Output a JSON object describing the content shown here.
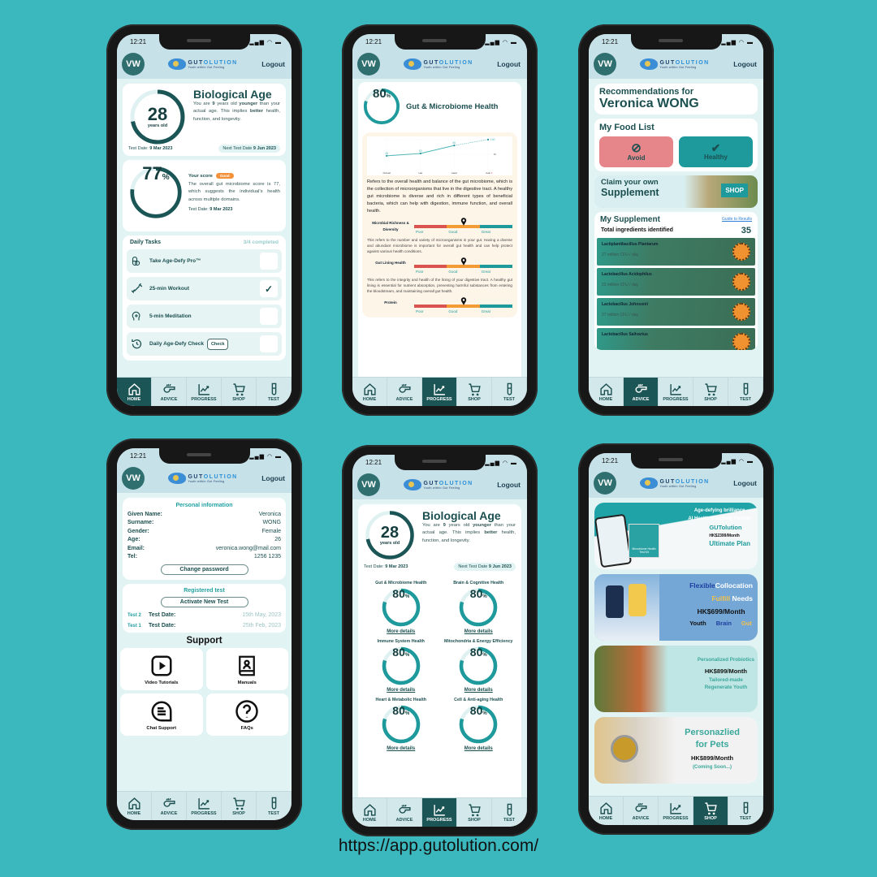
{
  "status_time": "12:21",
  "header": {
    "avatar": "VW",
    "brand_a": "GUT",
    "brand_b": "OLUTION",
    "tagline": "Youth within Gut Feeling",
    "logout": "Logout"
  },
  "nav": [
    {
      "label": "HOME",
      "icon": "home-icon"
    },
    {
      "label": "ADVICE",
      "icon": "whistle-icon"
    },
    {
      "label": "PROGRESS",
      "icon": "progress-chart-icon"
    },
    {
      "label": "SHOP",
      "icon": "cart-icon"
    },
    {
      "label": "TEST",
      "icon": "test-tube-icon"
    }
  ],
  "colors": {
    "background": "#3bb8be",
    "dark_teal": "#1b5556",
    "teal": "#1f9a9c",
    "poor": "#d9534f",
    "good": "#f39c35",
    "great": "#1f9a9c",
    "badge": "#f2913a"
  },
  "home": {
    "active_nav": "HOME",
    "bio": {
      "age": "28",
      "unit": "years old",
      "ring_fill": 0.72,
      "title": "Biological Age",
      "desc_1": "You are ",
      "years": "9",
      "desc_2": " years old ",
      "younger": "younger",
      "desc_3": " than your actual age.  This implies ",
      "better": "better",
      "desc_4": " health, function, and longevity.",
      "test_date_label": "Test Date: ",
      "test_date": "9 Mar 2023",
      "next_label": "Next Test Date ",
      "next_date": "9 Jun 2023"
    },
    "score": {
      "value": "77",
      "pct": "%",
      "ring_fill": 0.77,
      "label": "Your score",
      "badge": "Good",
      "desc": "The overall gut microbiome score is 77, which suggests the individual's health across multiple domains.",
      "test_date_label": "Test Date: ",
      "test_date": "9 Mar 2023"
    },
    "tasks": {
      "title": "Daily Tasks",
      "completed": "3/4 completed",
      "items": [
        {
          "label": "Take Age-Defy Pro™",
          "icon": "pill-icon",
          "done": false
        },
        {
          "label": "25-min Workout",
          "icon": "dumbbell-icon",
          "done": true
        },
        {
          "label": "5-min Meditation",
          "icon": "meditation-head-icon",
          "done": false
        },
        {
          "label": "Daily Age-Defy Check",
          "icon": "history-icon",
          "done": false,
          "button": "Check"
        }
      ]
    }
  },
  "progress_detail": {
    "active_nav": "PROGRESS",
    "score": "80",
    "pct": "%",
    "ring_fill": 0.8,
    "title": "Gut & Microbiome Health",
    "desc": "Refers to the overall health and balance of the gut microbiome, which is the collection of microorganisms that live in the digestive tract. A healthy gut microbiome is diverse and rich in different types of beneficial bacteria, which can help with digestion, immune function, and overall health.",
    "scale": [
      "Poor",
      "Good",
      "Great"
    ],
    "metrics": [
      {
        "label": "Microbial Richness & Diversity",
        "level": "Good",
        "desc": "This refers to the number and variety of microorganisms in your gut. Having a diverse and abundant microbiome is important for overall gut health and can help protect against various health conditions."
      },
      {
        "label": "Gut Lining Health",
        "level": "Good",
        "desc": "This refers to the integrity and health of the lining of your digestive tract. A healthy gut lining is essential for nutrient absorption, preventing harmful substances from entering the bloodstream, and maintaining overall gut health."
      },
      {
        "label": "Protein",
        "level": "Good",
        "desc": ""
      }
    ]
  },
  "chart_data": {
    "type": "line",
    "categories": [
      "2nd Last",
      "Last",
      "Latest",
      "Goal"
    ],
    "values": [
      45,
      53,
      80,
      100
    ],
    "ylim": [
      0,
      100
    ],
    "yticks": [
      "50",
      "100"
    ],
    "goal_marker": "0",
    "grid": true,
    "goal_segment": "dashed"
  },
  "advice": {
    "active_nav": "ADVICE",
    "rec_label": "Recommendations for",
    "rec_name": "Veronica WONG",
    "food_title": "My Food List",
    "avoid": "Avoid",
    "healthy": "Healthy",
    "claim_1": "Claim your own",
    "claim_2": "Supplement",
    "shop": "SHOP",
    "supp_title": "My Supplement",
    "guide": "Guide to Results",
    "total_label": "Total ingredients identified",
    "total": "35",
    "supplements": [
      {
        "name": "Lactiplantibacillus Plantarum",
        "dose": "27 million CFU / day"
      },
      {
        "name": "Lactobacillus Acidophilus",
        "dose": "22 million CFU / day"
      },
      {
        "name": "Lactobacillus Johnsonii",
        "dose": "27 million CFU / day"
      },
      {
        "name": "Lactobacillus Salivarius",
        "dose": ""
      }
    ]
  },
  "profile": {
    "active_nav": "",
    "personal_title": "Personal information",
    "fields": [
      {
        "k": "Given Name:",
        "v": "Veronica"
      },
      {
        "k": "Surname:",
        "v": "WONG"
      },
      {
        "k": "Gender:",
        "v": "Female"
      },
      {
        "k": "Age:",
        "v": "26"
      },
      {
        "k": "Email:",
        "v": "veronica.wong@mail.com"
      },
      {
        "k": "Tel:",
        "v": "1256 1235"
      }
    ],
    "change_password": "Change password",
    "registered_title": "Registered test",
    "activate": "Activate New Test",
    "tests": [
      {
        "id": "Test 2",
        "label": "Test Date:",
        "date": "15th May, 2023"
      },
      {
        "id": "Test 1",
        "label": "Test Date:",
        "date": "25th Feb, 2023"
      }
    ],
    "support_title": "Support",
    "support": [
      {
        "label": "Video Tutorials",
        "icon": "video-play-icon"
      },
      {
        "label": "Manuals",
        "icon": "manual-book-icon"
      },
      {
        "label": "Chat Support",
        "icon": "chat-icon"
      },
      {
        "label": "FAQs",
        "icon": "question-icon"
      }
    ]
  },
  "progress": {
    "active_nav": "PROGRESS",
    "categories": [
      {
        "title": "Gut & Microbiome Health",
        "value": "80",
        "ring_fill": 0.8
      },
      {
        "title": "Brain & Cognitive Health",
        "value": "80",
        "ring_fill": 0.8
      },
      {
        "title": "Immune System Health",
        "value": "80",
        "ring_fill": 0.8
      },
      {
        "title": "Mitochondria & Energy Efficiency",
        "value": "80",
        "ring_fill": 0.8
      },
      {
        "title": "Heart & Metabolic Health",
        "value": "80",
        "ring_fill": 0.8
      },
      {
        "title": "Cell & Anti-aging Health",
        "value": "80",
        "ring_fill": 0.8
      }
    ],
    "pct": "%",
    "more": "More details"
  },
  "shop": {
    "active_nav": "SHOP",
    "p1": {
      "l1": "Age-defying brilliance",
      "l2": "AI Health Coaching Partner",
      "brand": "GUTolution",
      "price": "HK$2399/Month",
      "plan": "Ultimate Plan",
      "kit": "Microbiome Health Test Kit"
    },
    "p2": {
      "flex": "Flexible",
      "coll": "Collocation",
      "fulfill": "Fulfill",
      "needs": " Needs",
      "price": "HK$699/Month",
      "youth": "Youth",
      "brain": "Brain",
      "gut": "Gut"
    },
    "p3": {
      "title": "Personalized Probiotics",
      "price": "HK$899/Month",
      "l1": "Tailored-made",
      "l2": "Regenerate Youth"
    },
    "p4": {
      "title_1": "Personazlied",
      "title_2": "for Pets",
      "price": "HK$899/Month",
      "note": "(Coming Soon...)"
    }
  },
  "footer_url": "https://app.gutolution.com/"
}
